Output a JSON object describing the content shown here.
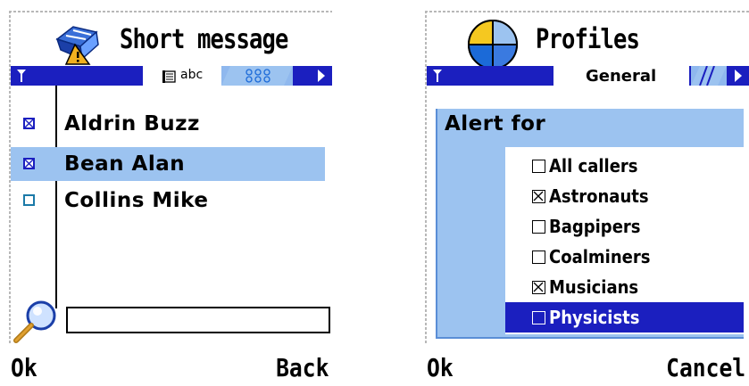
{
  "short_message_screen": {
    "title": "Short message",
    "active_tab": "abc",
    "inactive_tab": "ꟷ",
    "contacts": [
      {
        "name": "Aldrin Buzz",
        "checked": true,
        "selected": false
      },
      {
        "name": "Bean Alan",
        "checked": true,
        "selected": true
      },
      {
        "name": "Collins Mike",
        "checked": false,
        "selected": false
      }
    ],
    "search_value": "",
    "softkey_left": "Ok",
    "softkey_right": "Back"
  },
  "profiles_screen": {
    "title": "Profiles",
    "tab_label": "General",
    "dialog_title": "Alert for",
    "options": [
      {
        "label": "All callers",
        "checked": false,
        "selected": false
      },
      {
        "label": "Astronauts",
        "checked": true,
        "selected": false
      },
      {
        "label": "Bagpipers",
        "checked": false,
        "selected": false
      },
      {
        "label": "Coalminers",
        "checked": false,
        "selected": false
      },
      {
        "label": "Musicians",
        "checked": true,
        "selected": false
      },
      {
        "label": "Physicists",
        "checked": false,
        "selected": true
      }
    ],
    "softkey_left": "Ok",
    "softkey_right": "Cancel"
  },
  "colors": {
    "tab_bar": "#1b1fbf",
    "highlight": "#9cc3f0",
    "selection": "#1b1fbf"
  }
}
